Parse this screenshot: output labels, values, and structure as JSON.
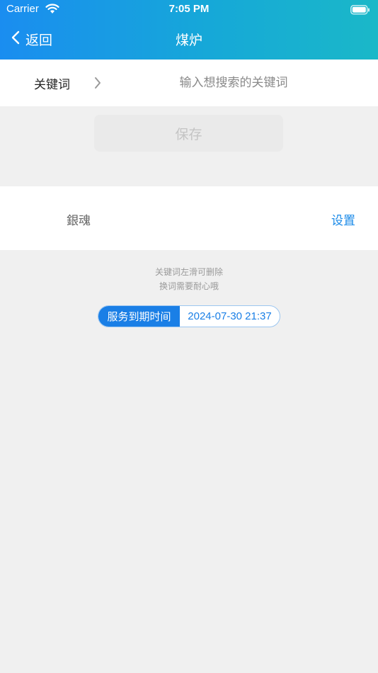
{
  "status_bar": {
    "carrier": "Carrier",
    "time": "7:05 PM"
  },
  "nav": {
    "back_label": "返回",
    "title": "煤炉"
  },
  "keyword": {
    "label": "关键词",
    "placeholder": "输入想搜索的关键词",
    "value": ""
  },
  "save_button": {
    "label": "保存"
  },
  "keyword_item": {
    "name": "銀魂",
    "action_label": "设置"
  },
  "hints": [
    "关键词左滑可删除",
    "换词需要耐心哦"
  ],
  "service": {
    "label": "服务到期时间",
    "expiry": "2024-07-30 21:37"
  },
  "colors": {
    "header_start": "#1a8df0",
    "header_end": "#1ab8c8",
    "accent": "#1a7fe6",
    "background": "#f0f0f0"
  }
}
